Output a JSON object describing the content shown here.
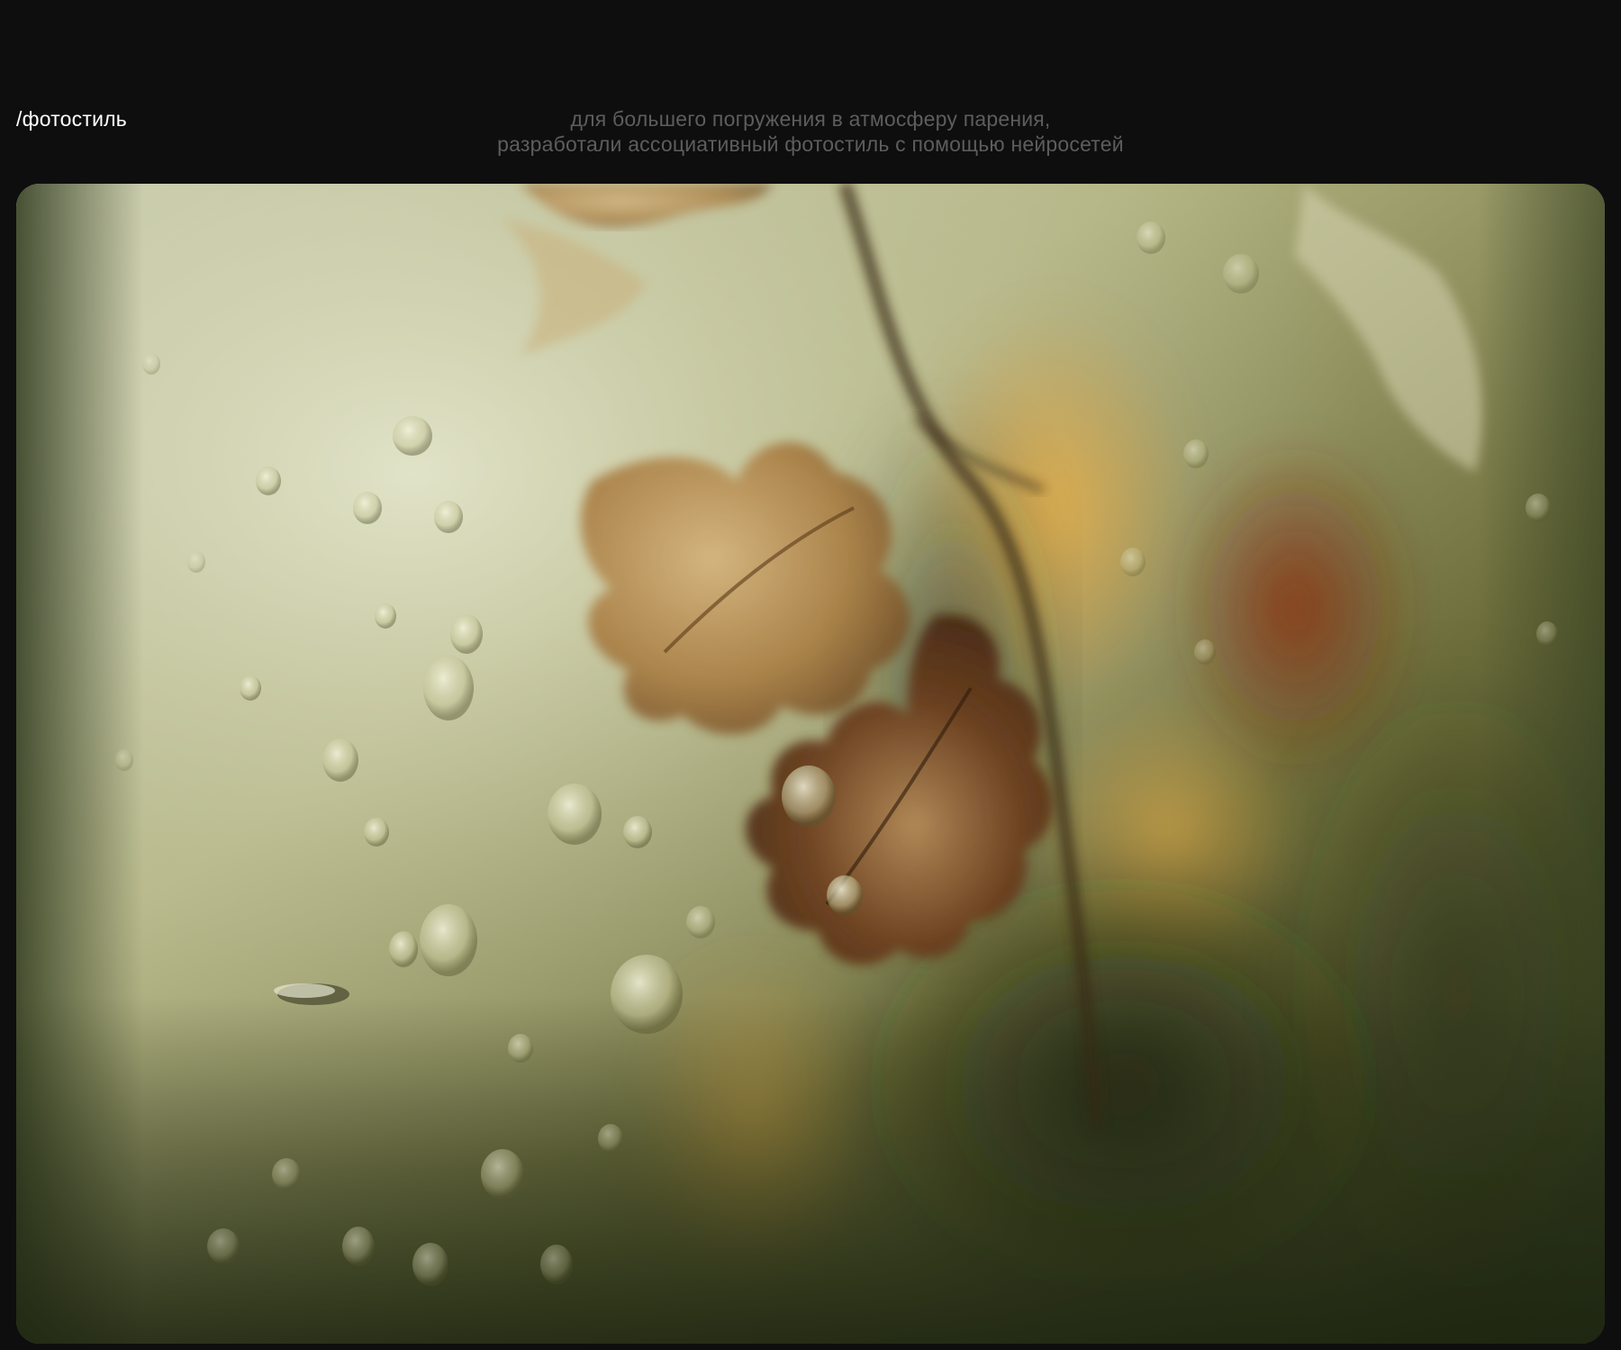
{
  "section": {
    "label": "/фотостиль",
    "description_line1": "для большего погружения в атмосферу парения,",
    "description_line2": "разработали ассоциативный фотостиль с помощью нейросетей"
  },
  "photo": {
    "subject": "autumn leaves behind fogged glass with water drops",
    "colors": {
      "background": "#0e0e0e",
      "label": "#ffffff",
      "description": "#5d5d5d",
      "fog_light": "#c9caa6",
      "fog_mid": "#8f9262",
      "moss_dark": "#2f3a1e",
      "leaf_warm": "#a87a3e",
      "leaf_dark": "#4a2a14",
      "glow_amber": "#d49a3c",
      "red_accent": "#7a2e14"
    }
  }
}
